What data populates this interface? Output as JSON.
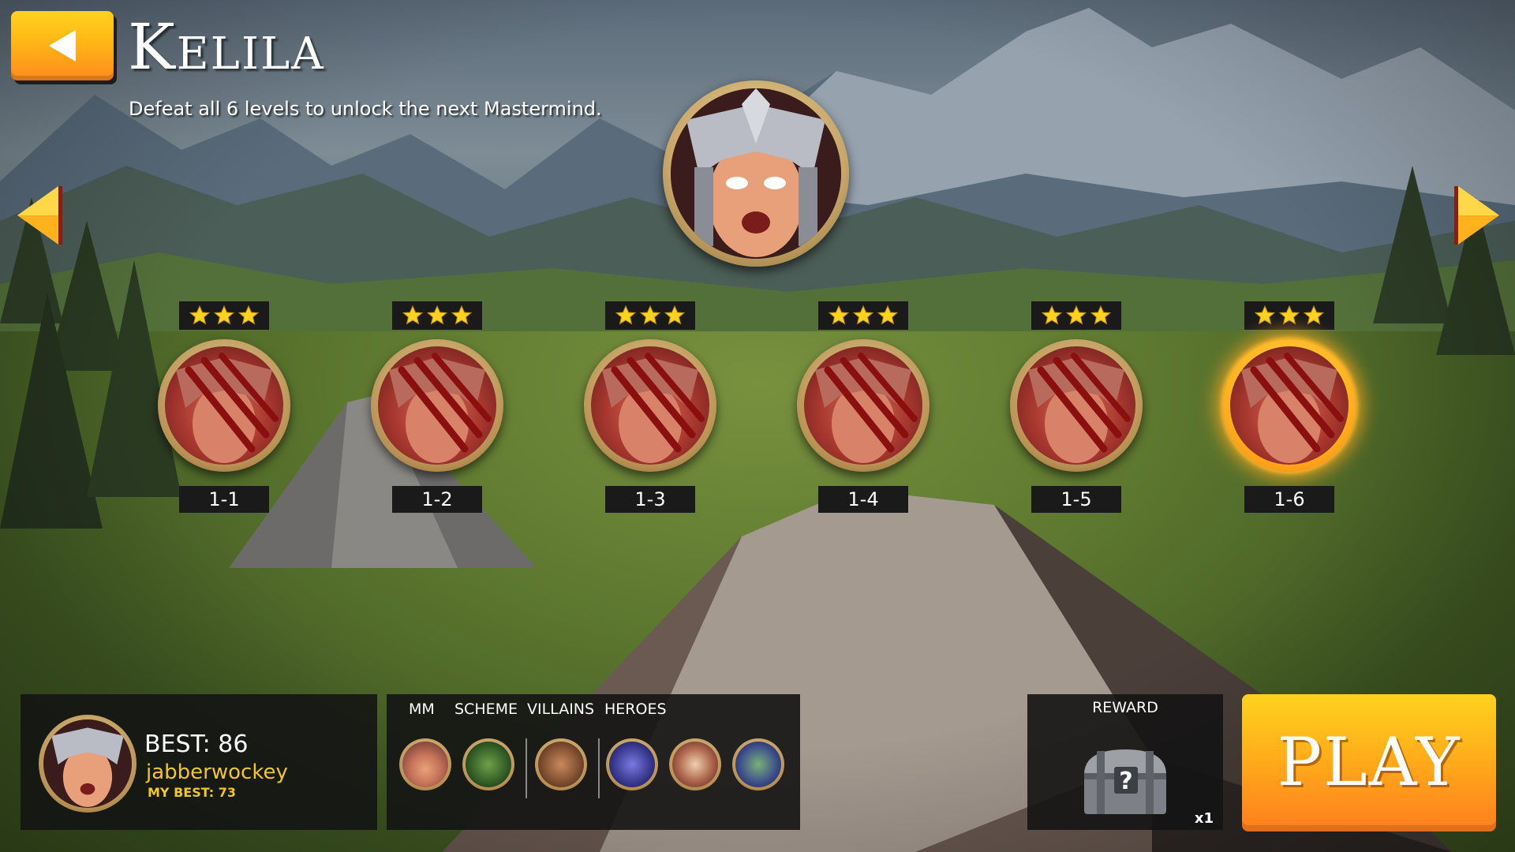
{
  "header": {
    "title": "Kelila",
    "subtitle": "Defeat all 6 levels to unlock the next Mastermind."
  },
  "icons": {
    "back": "back-arrow-icon",
    "prev": "chevron-left-icon",
    "next": "chevron-right-icon",
    "star": "star-icon",
    "reward": "mystery-chest-icon"
  },
  "levels": [
    {
      "label": "1-1",
      "stars": 3,
      "selected": false
    },
    {
      "label": "1-2",
      "stars": 3,
      "selected": false
    },
    {
      "label": "1-3",
      "stars": 3,
      "selected": false
    },
    {
      "label": "1-4",
      "stars": 3,
      "selected": false
    },
    {
      "label": "1-5",
      "stars": 3,
      "selected": false
    },
    {
      "label": "1-6",
      "stars": 3,
      "selected": true
    }
  ],
  "best": {
    "score_label": "BEST: 86",
    "player": "jabberwockey",
    "my_best": "MY BEST: 73"
  },
  "team": {
    "headers": [
      "MM",
      "SCHEME",
      "VILLAINS",
      "HEROES"
    ]
  },
  "reward": {
    "label": "REWARD",
    "count": "x1"
  },
  "play": {
    "label": "PLAY"
  },
  "colors": {
    "accent": "#ffb616",
    "highlight": "#f2c81e",
    "panel": "#141414"
  }
}
